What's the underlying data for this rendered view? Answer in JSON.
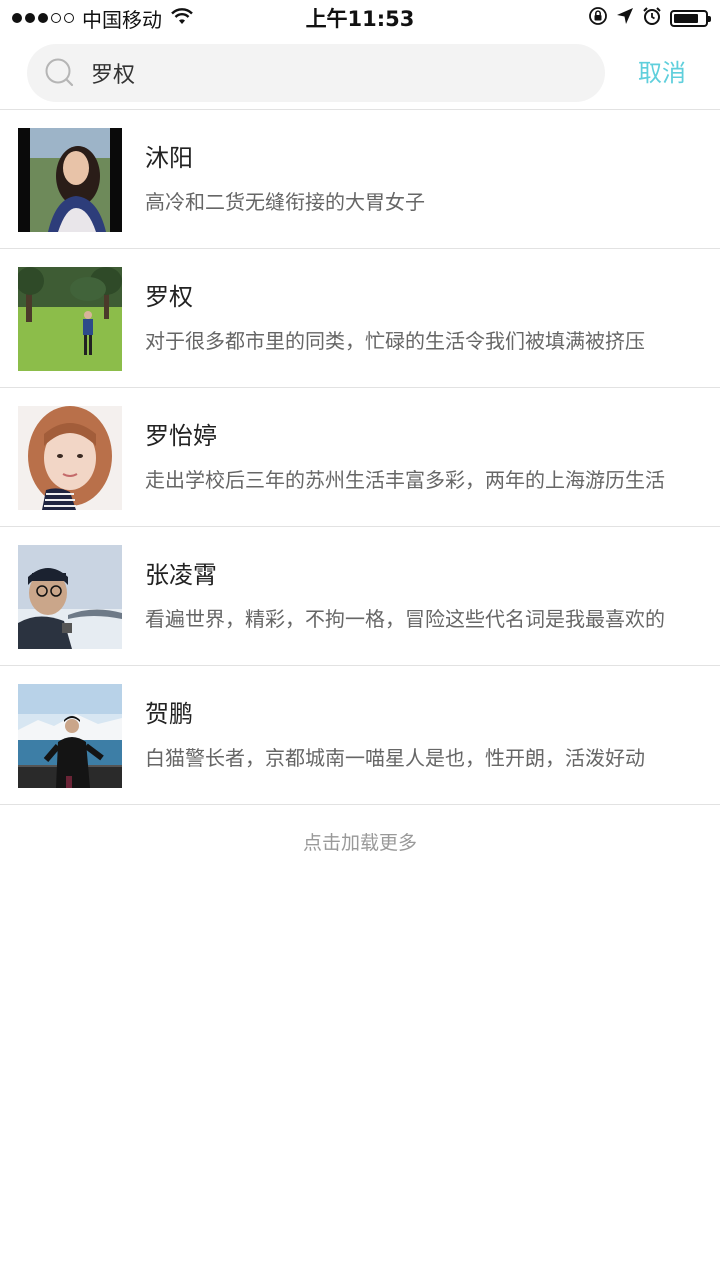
{
  "status_bar": {
    "carrier": "中国移动",
    "time": "上午11:53",
    "signal_filled": 3,
    "signal_total": 5,
    "battery_level_percent": 80,
    "icons": [
      "wifi-icon",
      "orientation-lock-icon",
      "location-arrow-icon",
      "alarm-icon",
      "battery-icon"
    ]
  },
  "search": {
    "value": "罗权",
    "icon": "search-icon",
    "cancel_label": "取消"
  },
  "results": [
    {
      "name": "沐阳",
      "desc": "高冷和二货无缝衔接的大胃女子"
    },
    {
      "name": "罗权",
      "desc": "对于很多都市里的同类，忙碌的生活令我们被填满被挤压"
    },
    {
      "name": "罗怡婷",
      "desc": "走出学校后三年的苏州生活丰富多彩，两年的上海游历生活"
    },
    {
      "name": "张凌霄",
      "desc": "看遍世界，精彩，不拘一格，冒险这些代名词是我最喜欢的"
    },
    {
      "name": "贺鹏",
      "desc": "白猫警长者，京都城南一喵星人是也，性开朗，活泼好动"
    }
  ],
  "load_more_label": "点击加载更多",
  "colors": {
    "accent": "#5fcfdc",
    "divider": "#e2e2e2",
    "search_bg": "#f3f3f3"
  }
}
